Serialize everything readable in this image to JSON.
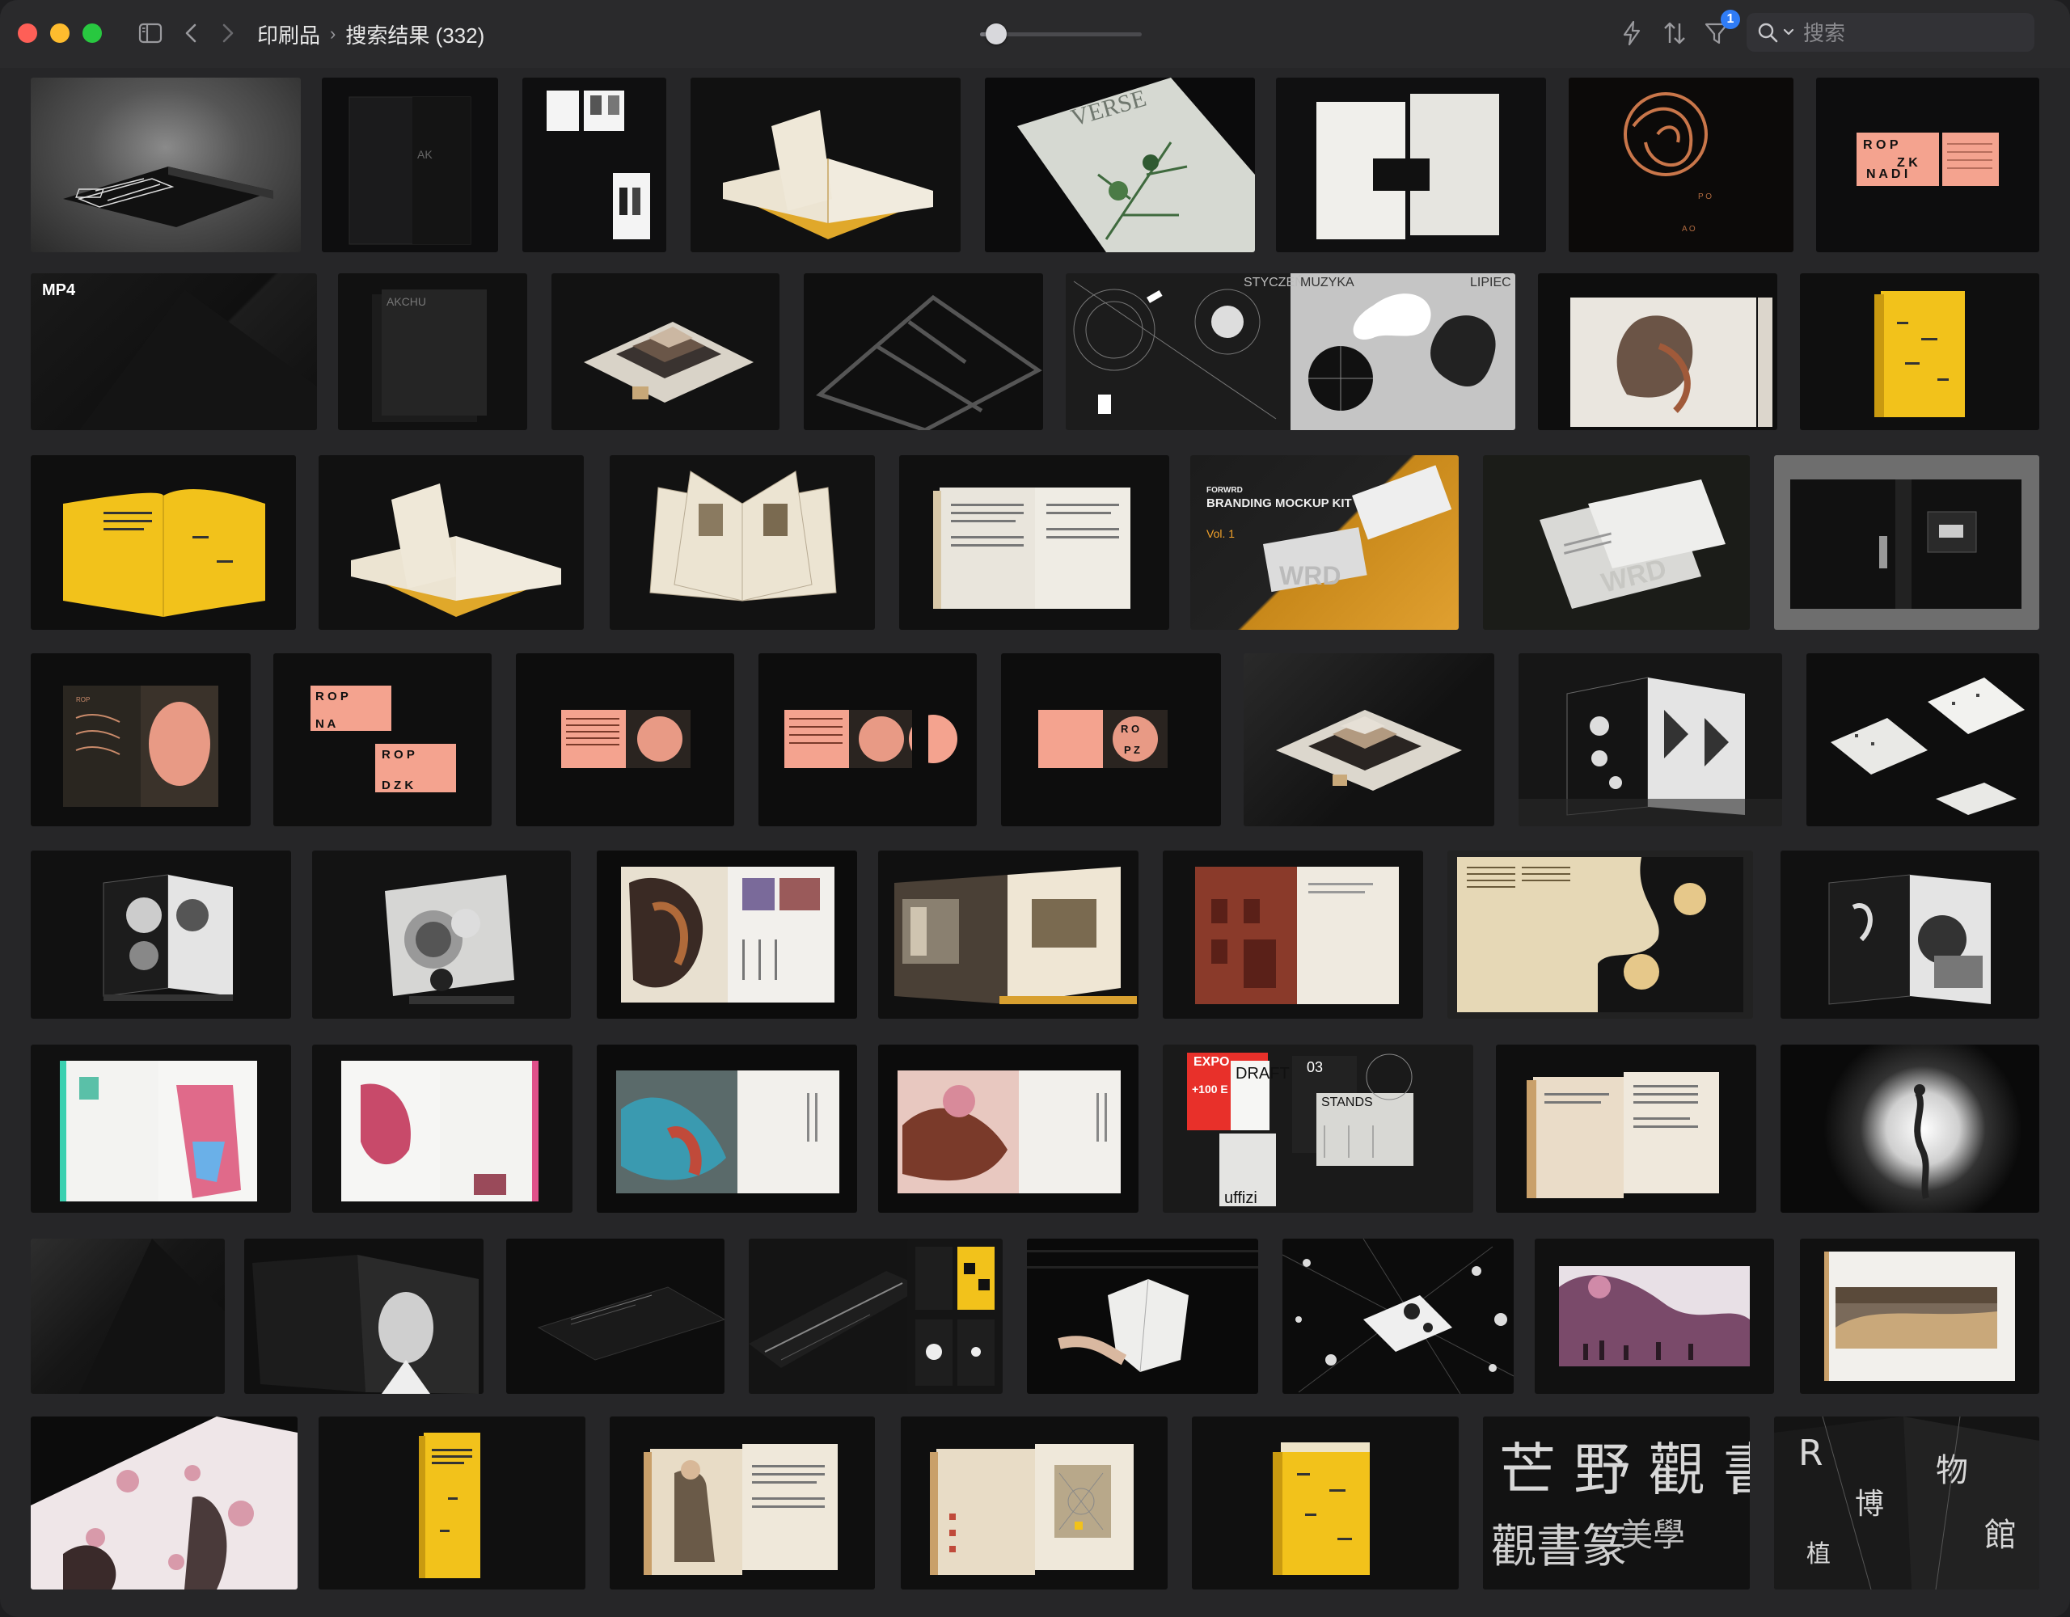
{
  "window": {
    "breadcrumb": {
      "parent": "印刷品",
      "current": "搜索结果 (332)"
    },
    "zoom_level": 0.1,
    "filter_badge": "1",
    "search": {
      "placeholder": "搜索",
      "value": ""
    }
  },
  "icons": [
    "sidebar-toggle-icon",
    "chevron-left-icon",
    "chevron-right-icon",
    "bolt-icon",
    "sort-icon",
    "filter-icon",
    "search-icon",
    "chevron-down-icon"
  ],
  "thumbnail_text": {
    "mp4_badge": "MP4",
    "verse": "VERSE",
    "forwrd": "FORWRD",
    "branding_title": "BRANDING MOCKUP KIT",
    "vol": "Vol. 1",
    "styczen": "STYCZEŃ",
    "muzyka": "MUZYKA",
    "lipiec": "LIPIEC",
    "expo": "EXPO",
    "draft": "DRAFT",
    "stands": "STANDS",
    "num03": "03",
    "uffizi": "uffizi",
    "kanji": "芒 野 觀 書 篆 師"
  },
  "colors": {
    "window_bg": "#262628",
    "toolbar_bg": "#2a2a2c",
    "accent_badge": "#2f7cf6",
    "yellow_book": "#f2c21b",
    "salmon": "#f4a38f"
  }
}
